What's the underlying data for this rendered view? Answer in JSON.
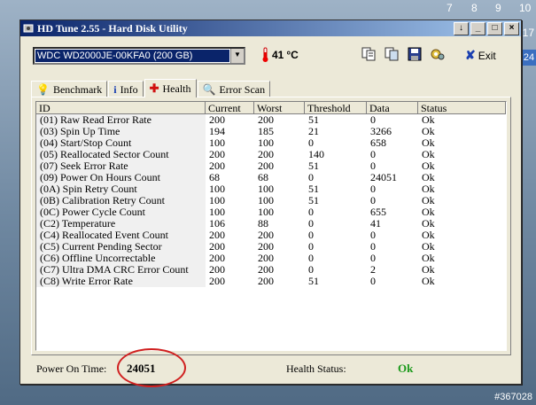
{
  "desktop": {
    "calendar": [
      "7",
      "8",
      "9",
      "10"
    ],
    "side_numbers": [
      "17",
      "24"
    ],
    "watermark": "#367028"
  },
  "window": {
    "title": "HD Tune 2.55 - Hard Disk Utility",
    "controls": [
      "↓",
      "_",
      "□",
      "×"
    ]
  },
  "toolbar": {
    "drive": "WDC WD2000JE-00KFA0 (200 GB)",
    "temperature": "41",
    "temperature_unit": "°C",
    "exit_label": "Exit"
  },
  "tabs": [
    "Benchmark",
    "Info",
    "Health",
    "Error Scan"
  ],
  "table": {
    "headers": [
      "ID",
      "Current",
      "Worst",
      "Threshold",
      "Data",
      "Status"
    ],
    "rows": [
      [
        "(01) Raw Read Error Rate",
        "200",
        "200",
        "51",
        "0",
        "Ok"
      ],
      [
        "(03) Spin Up Time",
        "194",
        "185",
        "21",
        "3266",
        "Ok"
      ],
      [
        "(04) Start/Stop Count",
        "100",
        "100",
        "0",
        "658",
        "Ok"
      ],
      [
        "(05) Reallocated Sector Count",
        "200",
        "200",
        "140",
        "0",
        "Ok"
      ],
      [
        "(07) Seek Error Rate",
        "200",
        "200",
        "51",
        "0",
        "Ok"
      ],
      [
        "(09) Power On Hours Count",
        "68",
        "68",
        "0",
        "24051",
        "Ok"
      ],
      [
        "(0A) Spin Retry Count",
        "100",
        "100",
        "51",
        "0",
        "Ok"
      ],
      [
        "(0B) Calibration Retry Count",
        "100",
        "100",
        "51",
        "0",
        "Ok"
      ],
      [
        "(0C) Power Cycle Count",
        "100",
        "100",
        "0",
        "655",
        "Ok"
      ],
      [
        "(C2) Temperature",
        "106",
        "88",
        "0",
        "41",
        "Ok"
      ],
      [
        "(C4) Reallocated Event Count",
        "200",
        "200",
        "0",
        "0",
        "Ok"
      ],
      [
        "(C5) Current Pending Sector",
        "200",
        "200",
        "0",
        "0",
        "Ok"
      ],
      [
        "(C6) Offline Uncorrectable",
        "200",
        "200",
        "0",
        "0",
        "Ok"
      ],
      [
        "(C7) Ultra DMA CRC Error Count",
        "200",
        "200",
        "0",
        "2",
        "Ok"
      ],
      [
        "(C8) Write Error Rate",
        "200",
        "200",
        "51",
        "0",
        "Ok"
      ]
    ]
  },
  "status": {
    "power_on_label": "Power On Time:",
    "power_on_value": "24051",
    "health_label": "Health Status:",
    "health_value": "Ok",
    "health_color": "#1c9a1c"
  }
}
